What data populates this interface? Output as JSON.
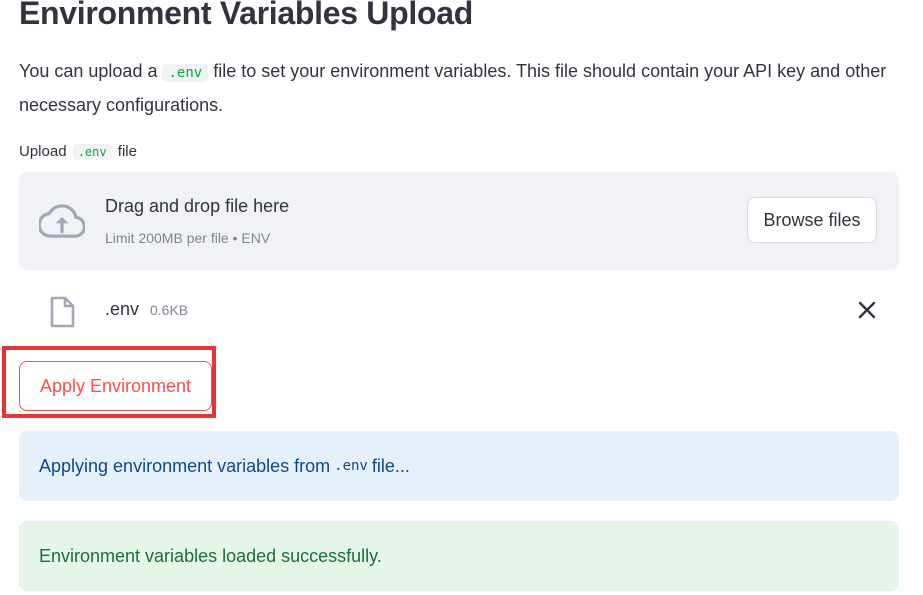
{
  "page": {
    "title": "Environment Variables Upload",
    "intro_before": "You can upload a ",
    "intro_code": ".env",
    "intro_after": " file to set your environment variables. This file should contain your API key and other necessary configurations."
  },
  "uploader": {
    "label_before": "Upload ",
    "label_code": ".env",
    "label_after": " file",
    "drop_title": "Drag and drop file here",
    "limit_text": "Limit 200MB per file • ENV",
    "browse_label": "Browse files",
    "icon": "cloud-upload-icon"
  },
  "file": {
    "name": ".env",
    "size": "0.6KB",
    "icon": "file-icon",
    "remove_icon": "close-icon"
  },
  "actions": {
    "apply_label": "Apply Environment"
  },
  "alerts": {
    "info_before": "Applying environment variables from ",
    "info_code": ".env",
    "info_after": " file...",
    "success": "Environment variables loaded successfully."
  },
  "colors": {
    "primary": "#ff4b4b",
    "highlight": "#e53535",
    "info_bg": "#e6f0fb",
    "info_text": "#0d4a8a",
    "success_bg": "#e5f5e9",
    "success_text": "#177233",
    "dropzone_bg": "#f0f2f6"
  }
}
